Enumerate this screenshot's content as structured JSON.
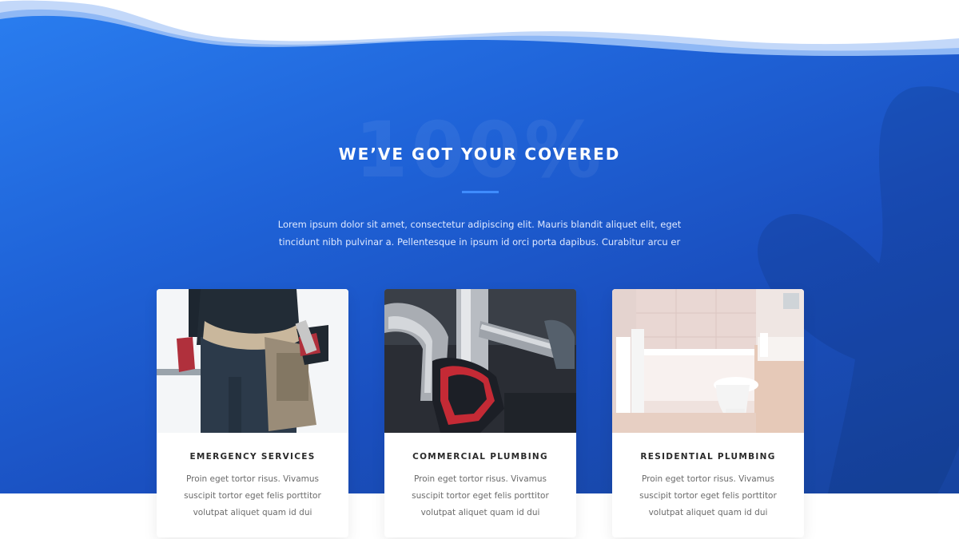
{
  "section": {
    "background_number": "100%",
    "title": "WE’VE GOT YOUR COVERED",
    "intro": "Lorem ipsum dolor sit amet, consectetur adipiscing elit. Mauris blandit aliquet elit, eget tincidunt nibh pulvinar a. Pellentesque in ipsum id orci porta dapibus. Curabitur arcu er"
  },
  "colors": {
    "hero_blue": "#1f63d8",
    "accent": "#3f8cff",
    "card_title": "#2a2a2a",
    "card_text": "#6b6b6b"
  },
  "cards": [
    {
      "title": "EMERGENCY SERVICES",
      "description": "Proin eget tortor risus. Vivamus suscipit tortor eget felis porttitor volutpat aliquet quam id dui",
      "image": "plumber-tool-belt-photo"
    },
    {
      "title": "COMMERCIAL PLUMBING",
      "description": "Proin eget tortor risus. Vivamus suscipit tortor eget felis porttitor volutpat aliquet quam id dui",
      "image": "wrench-on-pipe-photo"
    },
    {
      "title": "RESIDENTIAL PLUMBING",
      "description": "Proin eget tortor risus. Vivamus suscipit tortor eget felis porttitor volutpat aliquet quam id dui",
      "image": "bathroom-photo"
    }
  ]
}
